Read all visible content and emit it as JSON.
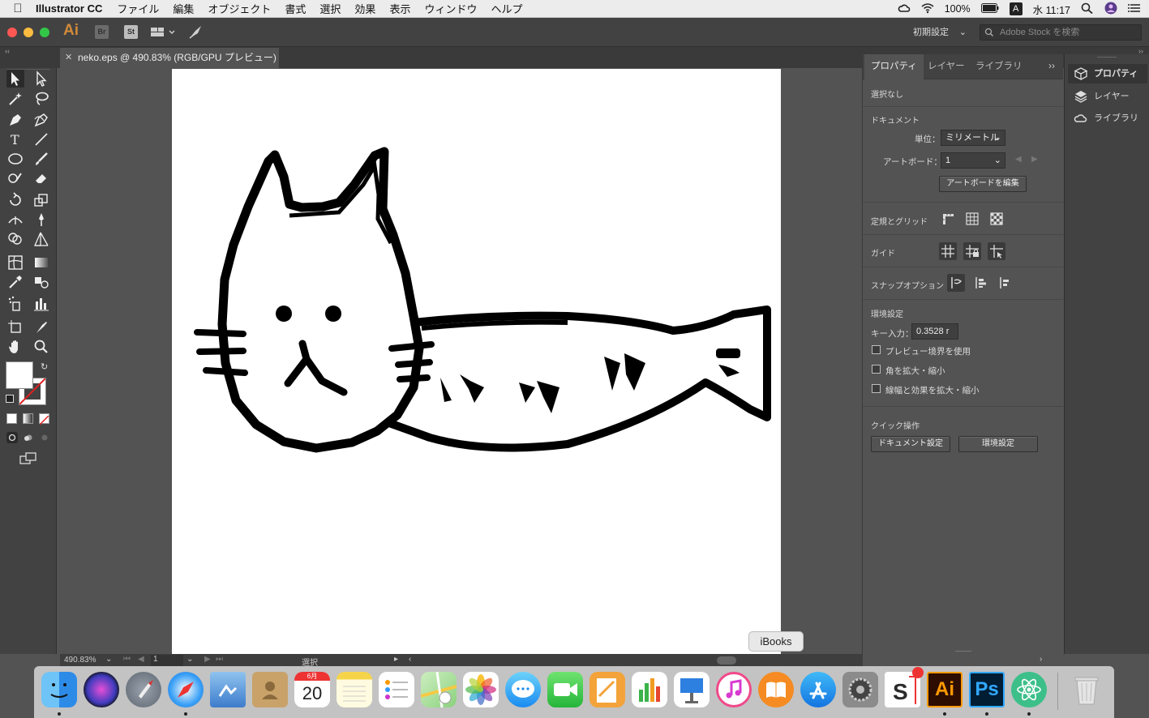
{
  "menubar": {
    "app_name": "Illustrator CC",
    "menus": [
      "ファイル",
      "編集",
      "オブジェクト",
      "書式",
      "選択",
      "効果",
      "表示",
      "ウィンドウ",
      "ヘルプ"
    ],
    "battery": "100%",
    "clock": "水 11:17"
  },
  "appbar": {
    "logo": "Ai",
    "bridge": "Br",
    "stock": "St",
    "workspace": "初期設定",
    "search_placeholder": "Adobe Stock を検索"
  },
  "document": {
    "tab_title": "neko.eps @ 490.83% (RGB/GPU プレビュー)"
  },
  "statusbar": {
    "zoom": "490.83%",
    "artboard": "1",
    "mode": "選択"
  },
  "panel": {
    "tabs": [
      "プロパティ",
      "レイヤー",
      "ライブラリ"
    ],
    "selection": "選択なし",
    "document_title": "ドキュメント",
    "unit_label": "単位：",
    "unit_value": "ミリメートル",
    "artboard_label": "アートボード：",
    "artboard_value": "1",
    "edit_artboard": "アートボードを編集",
    "rulers_grid": "定規とグリッド",
    "guides": "ガイド",
    "snap_options": "スナップオプション",
    "preferences": "環境設定",
    "key_input_label": "キー入力：",
    "key_input_value": "0.3528 r",
    "checkbox_preview_bounds": "プレビュー境界を使用",
    "checkbox_scale_corners": "角を拡大・縮小",
    "checkbox_scale_strokes": "線幅と効果を拡大・縮小",
    "quick_actions": "クイック操作",
    "doc_setup_button": "ドキュメント設定",
    "prefs_button": "環境設定"
  },
  "minipanel": {
    "items": [
      "プロパティ",
      "レイヤー",
      "ライブラリ"
    ]
  },
  "dock": {
    "tooltip": "iBooks",
    "calendar_month": "6月",
    "calendar_day": "20",
    "ai_label": "Ai",
    "ps_label": "Ps"
  },
  "colors": {
    "accent_ai": "#ff9a00",
    "ai_bg": "#2d0d00",
    "ps_bg": "#001d34",
    "ps_accent": "#31a8ff"
  }
}
